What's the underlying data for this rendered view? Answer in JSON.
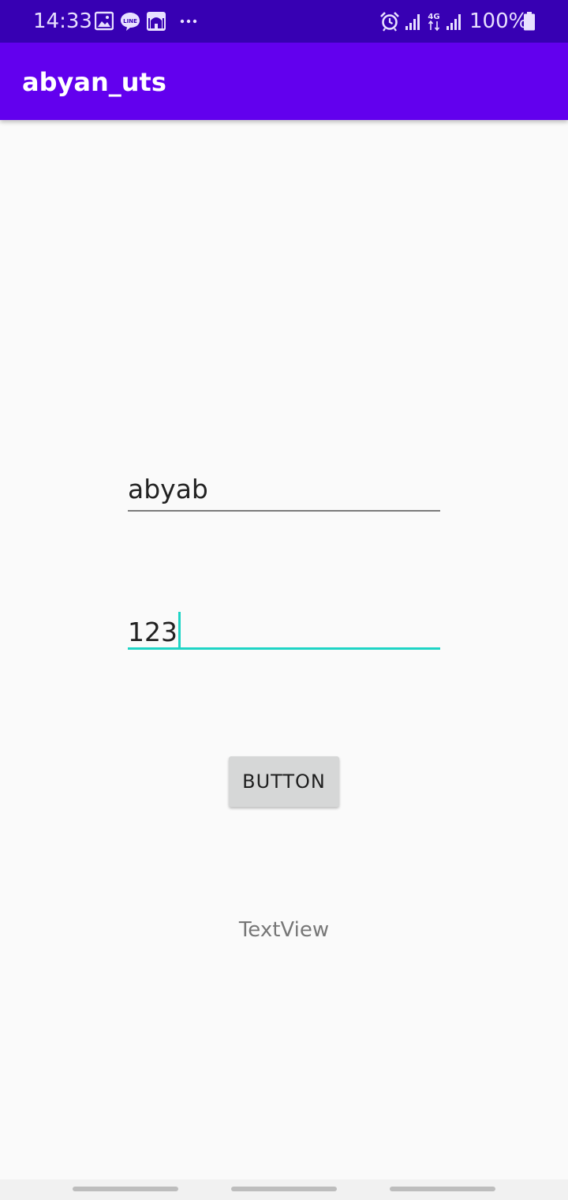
{
  "status_bar": {
    "time": "14:33",
    "battery_text": "100%",
    "left_icons": [
      "gallery-icon",
      "line-app-icon",
      "mosque-app-icon",
      "more-notifications-icon"
    ],
    "right_icons": [
      "alarm-icon",
      "signal-icon",
      "4g-data-icon",
      "signal-icon",
      "battery-icon"
    ],
    "network_label": "4G"
  },
  "app_bar": {
    "title": "abyan_uts"
  },
  "form": {
    "field1_value": "abyab",
    "field2_value": "123",
    "button_label": "BUTTON",
    "text_view": "TextView"
  },
  "colors": {
    "status_bar": "#3700b3",
    "app_bar": "#6200ee",
    "accent": "#1ed4c5",
    "background": "#fafafa",
    "button": "#d6d7d7"
  }
}
